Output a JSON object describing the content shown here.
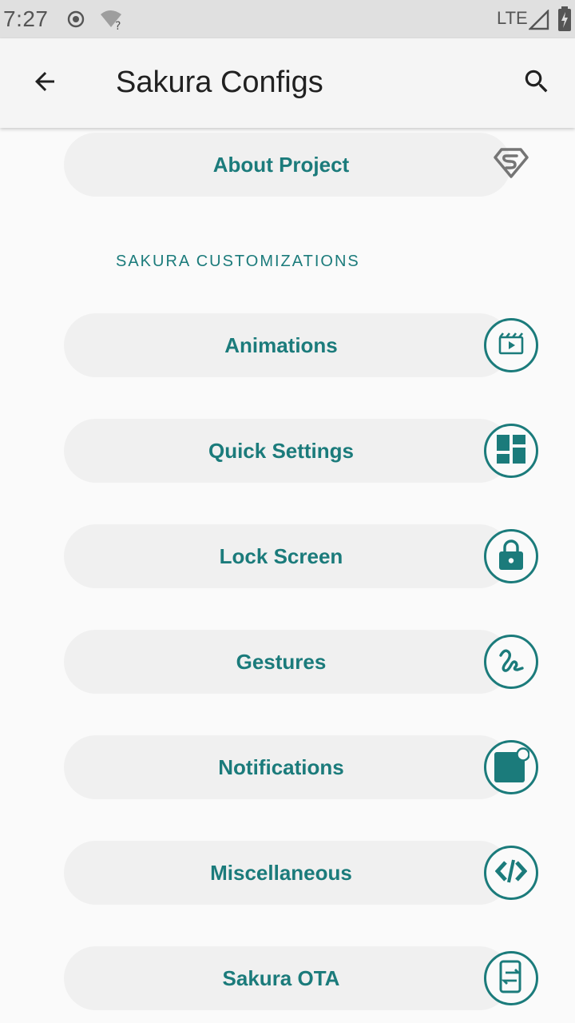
{
  "status_bar": {
    "time": "7:27",
    "network": "LTE",
    "icons": [
      "target-icon",
      "wifi-question-icon",
      "signal-icon",
      "battery-charging-icon"
    ]
  },
  "app_bar": {
    "title": "Sakura Configs",
    "back_icon": "arrow-back-icon",
    "search_icon": "search-icon"
  },
  "about": {
    "label": "About Project",
    "icon": "superman-logo-icon"
  },
  "section": {
    "title": "SAKURA CUSTOMIZATIONS"
  },
  "items": [
    {
      "label": "Animations",
      "icon": "movie-icon"
    },
    {
      "label": "Quick Settings",
      "icon": "dashboard-icon"
    },
    {
      "label": "Lock Screen",
      "icon": "lock-icon"
    },
    {
      "label": "Gestures",
      "icon": "gesture-icon"
    },
    {
      "label": "Notifications",
      "icon": "notification-badge-icon"
    },
    {
      "label": "Miscellaneous",
      "icon": "code-icon"
    },
    {
      "label": "Sakura OTA",
      "icon": "system-update-icon"
    }
  ],
  "colors": {
    "accent": "#1b7b7b",
    "pill_bg": "#f0f0f0",
    "page_bg": "#fafafa"
  }
}
